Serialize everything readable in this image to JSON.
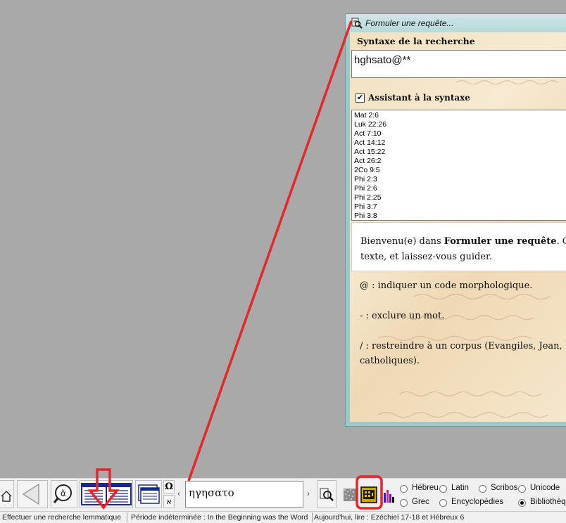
{
  "dialog": {
    "title": "Formuler une requête...",
    "syntax_heading": "Syntaxe de la recherche",
    "query_value": "hghsato@**",
    "assistant_label": "Assistant à la syntaxe",
    "assistant_checked": true,
    "references": [
      "Mat 2:6",
      "Luk 22:26",
      "Act 7:10",
      "Act 14:12",
      "Act 15:22",
      "Act 26:2",
      "2Co 9:5",
      "Phi 2:3",
      "Phi 2:6",
      "Phi 2:25",
      "Phi 3:7",
      "Phi 3:8"
    ],
    "welcome": {
      "prefix": "Bienvenu(e) dans ",
      "bold": "Formuler une requête",
      "after": ". C",
      "line2": "texte, et laissez-vous guider."
    },
    "help_lines": {
      "at": "@ : indiquer un code morphologique.",
      "minus": "- : exclure un mot.",
      "slash_1": "/ : restreindre à un corpus (Evangiles, Jean, I",
      "slash_2": "catholiques)."
    }
  },
  "toolbar": {
    "search_value": "ηγησατο",
    "omega_symbol": "Ω",
    "aleph_symbol": "א",
    "radio_options": [
      {
        "label": "Hébreu",
        "selected": false
      },
      {
        "label": "Latin",
        "selected": false
      },
      {
        "label": "Scribos",
        "selected": false
      },
      {
        "label": "Unicode",
        "selected": false
      },
      {
        "label": "Grec",
        "selected": false
      },
      {
        "label": "Encyclopédies",
        "selected": false
      },
      {
        "label": "Bibliothèqu",
        "selected": true
      }
    ]
  },
  "status_bar": {
    "hint": "Effectuer une recherche lemmatique",
    "period": "Période indéterminée : In the Beginning was the Word",
    "today": "Aujourd'hui, lire : Ezéchiel 17-18 et Hébreux 6"
  },
  "colors": {
    "annotation": "#e8262a",
    "window_frame": "#9fc9c9",
    "parchment": "#f2e1c0",
    "desktop": "#a9a9a9"
  }
}
